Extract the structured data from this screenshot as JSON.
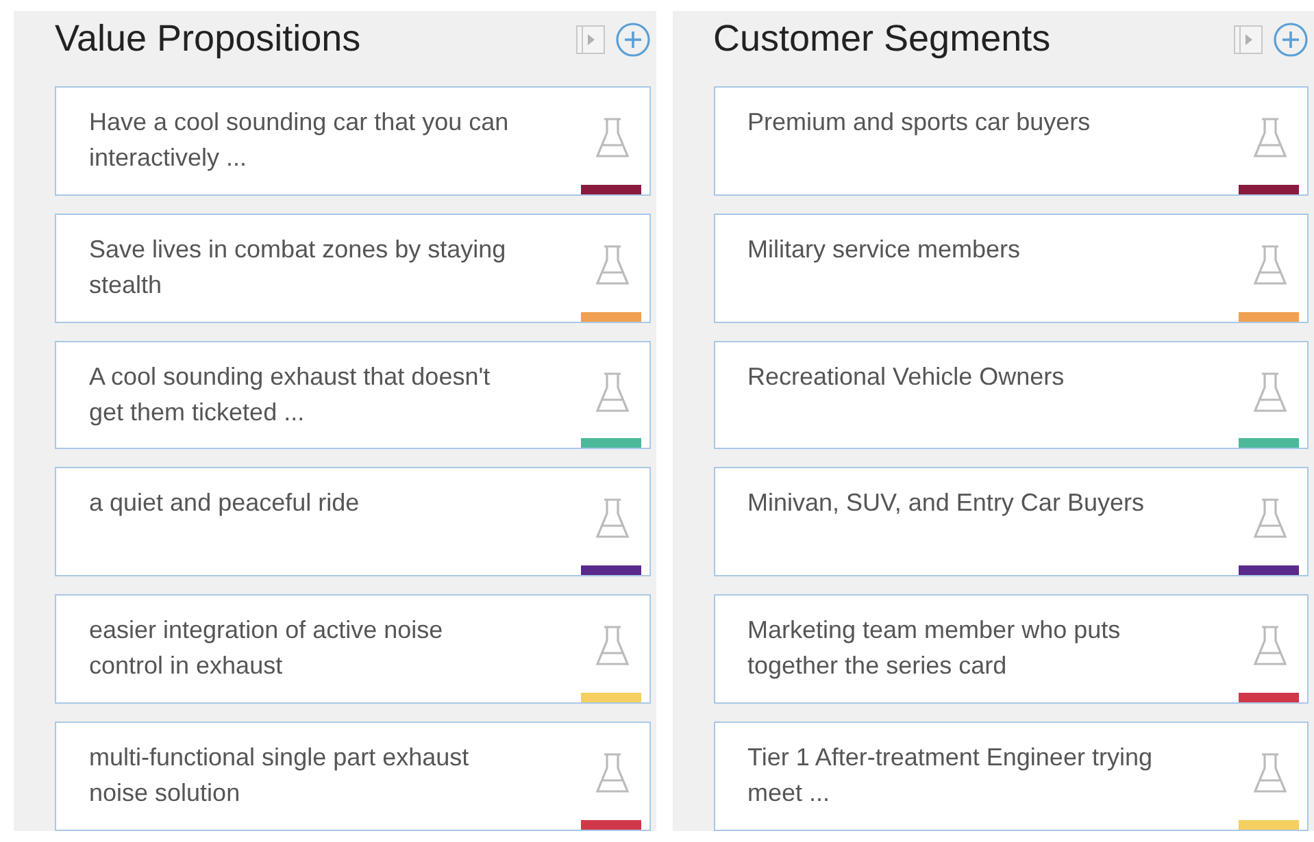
{
  "columns": [
    {
      "title": "Value Propositions",
      "cards": [
        {
          "text": "Have a cool sounding car that you can interactively ...",
          "color": "#8b1a3f"
        },
        {
          "text": "Save lives in combat zones by staying stealth",
          "color": "#f0a050"
        },
        {
          "text": "A cool sounding exhaust that doesn't get them ticketed ...",
          "color": "#4cb89a"
        },
        {
          "text": "a quiet and peaceful ride",
          "color": "#5a2a8a"
        },
        {
          "text": "easier integration of active noise control in exhaust",
          "color": "#f5d060"
        },
        {
          "text": "multi-functional single part exhaust noise solution",
          "color": "#d0384a"
        }
      ]
    },
    {
      "title": "Customer Segments",
      "cards": [
        {
          "text": "Premium and sports car buyers",
          "color": "#8b1a3f"
        },
        {
          "text": "Military service members",
          "color": "#f0a050"
        },
        {
          "text": "Recreational Vehicle Owners",
          "color": "#4cb89a"
        },
        {
          "text": "Minivan, SUV, and Entry Car Buyers",
          "color": "#5a2a8a"
        },
        {
          "text": "Marketing team member who puts together the series card",
          "color": "#d0384a"
        },
        {
          "text": "Tier 1 After-treatment Engineer trying meet ...",
          "color": "#f5d060"
        }
      ]
    }
  ]
}
